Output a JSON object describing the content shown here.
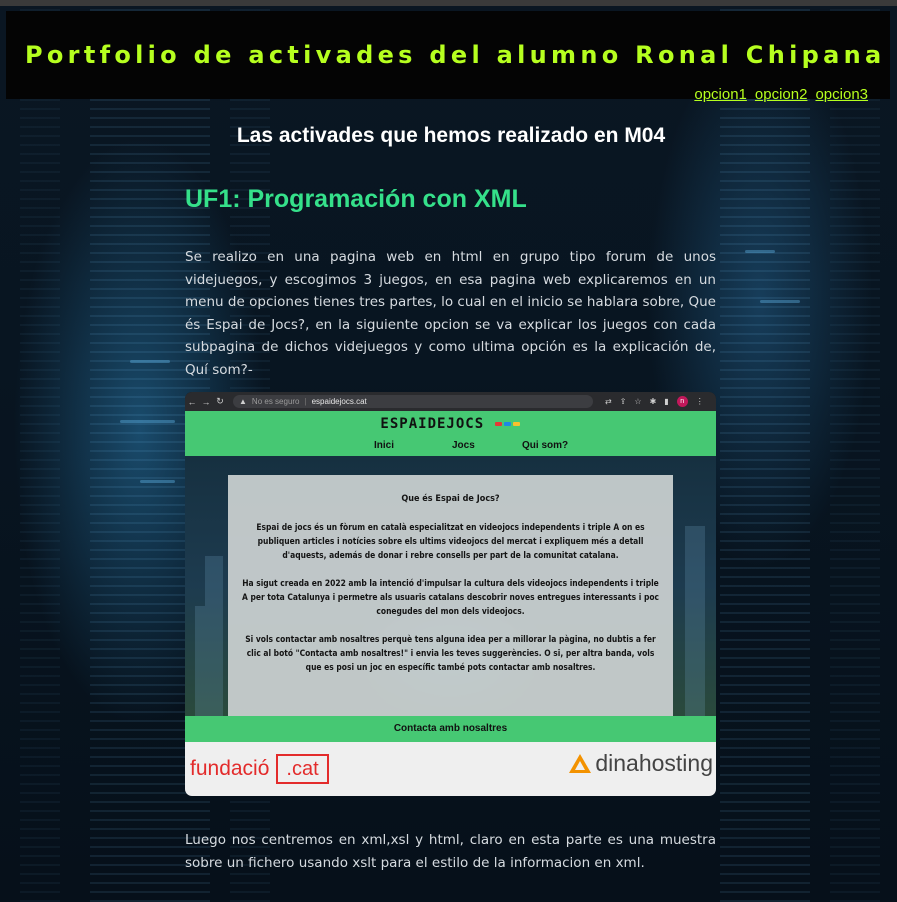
{
  "header": {
    "title": "Portfolio de activades del alumno Ronal Chipana"
  },
  "nav": {
    "items": [
      "opcion1",
      "opcion2",
      "opcion3"
    ]
  },
  "main": {
    "subtitle": "Las activades que hemos realizado en M04",
    "section_title": "UF1: Programación con XML",
    "paragraph1": "Se realizo en una pagina web en html en grupo tipo forum de unos videjuegos, y escogimos 3 juegos, en esa pagina web explicaremos en un menu de opciones tienes tres partes, lo cual en el inicio se hablara sobre, Que és Espai de Jocs?, en la siguiente opcion se va explicar los juegos con cada subpagina de dichos videjuegos y como ultima opción es la explicación de, Quí som?-",
    "paragraph2": "Luego nos centremos en xml,xsl y html, claro en esta parte es una muestra sobre un fichero usando xslt para el estilo de la informacion en xml."
  },
  "screenshot": {
    "browser": {
      "security": "No es seguro",
      "url": "espaidejocs.cat",
      "profile_initial": "n"
    },
    "site": {
      "logo": "ESPAIDEJOCS",
      "nav": [
        "Inici",
        "Jocs",
        "Qui som?"
      ],
      "card_heading": "Que és Espai de Jocs?",
      "card_p1": "Espai de jocs és un fòrum en català especialitzat en videojocs independents i triple A on es publiquen articles i notícies sobre els ultims videojocs del mercat i expliquem més a detall d'aquests, además de donar i rebre consells per part de la comunitat catalana.",
      "card_p2": "Ha sigut creada en 2022 amb la intenció d'impulsar la cultura dels videojocs independents i triple A per tota Catalunya i permetre als usuaris catalans descobrir noves entregues interessants i poc conegudes del mon dels videojocs.",
      "card_p3": "Si vols contactar amb nosaltres perquè tens alguna idea per a millorar la pàgina, no dubtis a fer clic al botó \"Contacta amb nosaltres!\" i envia les teves suggerències. O si, per altra banda, vols que es posi un joc en específic també pots contactar amb nosaltres.",
      "contact": "Contacta amb nosaltres",
      "sponsor1_a": "fundació",
      "sponsor1_b": ".cat",
      "sponsor2": "dinahosting"
    }
  },
  "colors": {
    "accent_title": "#b6ff1f",
    "section_title": "#35e08a",
    "site_green": "#46c873"
  },
  "icons": [
    "back-arrow-icon",
    "forward-arrow-icon",
    "reload-icon",
    "warning-icon",
    "translate-icon",
    "share-icon",
    "star-icon",
    "extensions-icon",
    "sidebar-icon",
    "profile-avatar",
    "kebab-menu-icon"
  ]
}
